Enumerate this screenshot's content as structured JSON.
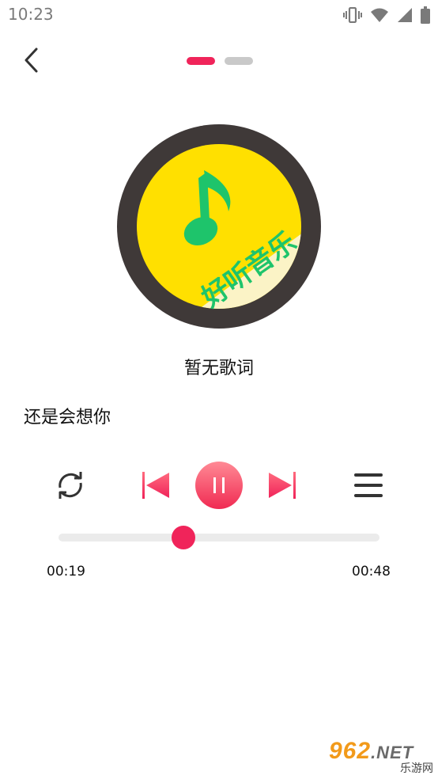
{
  "status_bar": {
    "time": "10:23",
    "icons": [
      "vibrate-icon",
      "wifi-icon",
      "signal-icon",
      "battery-icon"
    ]
  },
  "header": {
    "back_icon": "chevron-left-icon",
    "pages": {
      "count": 2,
      "active_index": 0
    }
  },
  "album_art": {
    "disc_color": "#3f3938",
    "cover_color": "#ffe000",
    "note_color": "#1ec46b",
    "banner_text": "好听音乐"
  },
  "lyrics": {
    "text": "暂无歌词"
  },
  "song": {
    "title": "还是会想你"
  },
  "controls": {
    "repeat_icon": "repeat-icon",
    "prev_icon": "skip-previous-icon",
    "play_icon": "pause-icon",
    "next_icon": "skip-next-icon",
    "list_icon": "playlist-icon"
  },
  "progress": {
    "current_time": "00:19",
    "total_time": "00:48",
    "fraction": 0.39
  },
  "colors": {
    "accent": "#f0245a",
    "track": "#ebebeb"
  },
  "watermark": {
    "top_digits": "962",
    "top_suffix": ".NET",
    "bottom_text": "乐游网"
  }
}
